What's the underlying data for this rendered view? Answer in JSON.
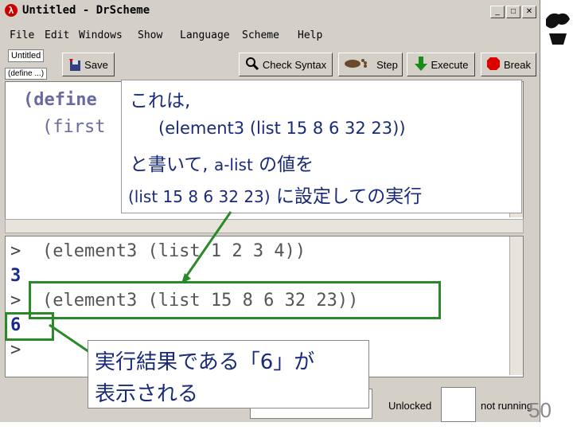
{
  "window": {
    "title": "Untitled - DrScheme",
    "logo_glyph": "λ",
    "min_glyph": "_",
    "max_glyph": "□",
    "close_glyph": "✕"
  },
  "menu": [
    "File",
    "Edit",
    "Windows",
    "Show",
    "Language",
    "Scheme",
    "Help"
  ],
  "doc": {
    "name_button": "Untitled",
    "define_popup": "(define ...)"
  },
  "toolbar": {
    "save": "Save",
    "check_syntax": "Check Syntax",
    "step": "Step",
    "execute": "Execute",
    "break": "Break"
  },
  "editor": {
    "line1_kw": "(define",
    "line2": "(first"
  },
  "callout": {
    "line1": "これは,",
    "line2": "(element3 (list 15 8 6 32 23))",
    "line3_a": "と書いて,",
    "line3_b": "a-list",
    "line3_c": "の値を",
    "line4_a": "(list 15 8 6 32 23)",
    "line4_b": "に設定しての実行"
  },
  "repl": {
    "prompt": ">",
    "expr1": "(element3 (list 1 2 3 4))",
    "res1": "3",
    "expr2": "(element3 (list 15 8 6 32 23))",
    "res2": "6"
  },
  "callout2": {
    "line1": "実行結果である「6」が",
    "line2": "表示される"
  },
  "status": {
    "locked": "Unlocked",
    "running": "not running"
  },
  "slide_number": "50",
  "colors": {
    "callout_text": "#1a2a7a",
    "highlight": "#2a8a2a",
    "arrow": "#2a8a2a"
  }
}
